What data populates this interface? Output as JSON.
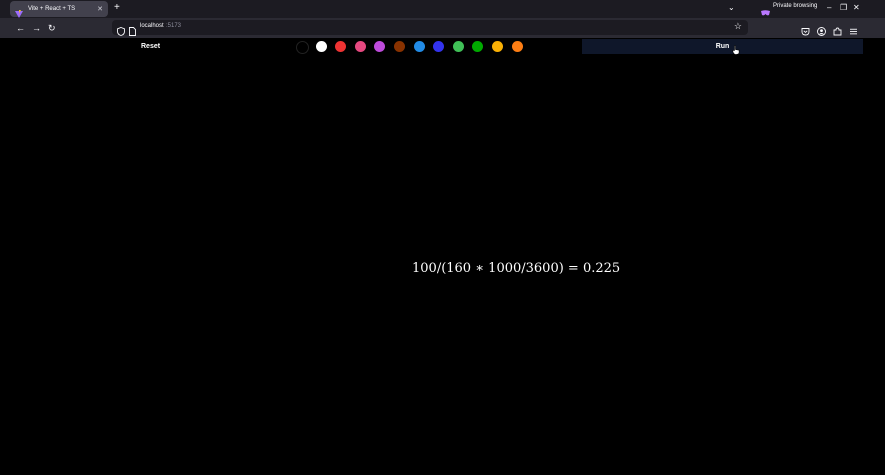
{
  "browser": {
    "tab": {
      "title": "Vite + React + TS",
      "favicon": "vite-logo-icon",
      "close_icon": "close-icon"
    },
    "new_tab_icon": "plus-icon",
    "tab_list_icon": "chevron-down-icon",
    "private_browsing_label": "Private browsing",
    "window_controls": [
      "minimize-icon",
      "restore-icon",
      "close-icon"
    ],
    "nav": {
      "back_icon": "back-arrow-icon",
      "forward_icon": "forward-arrow-icon",
      "reload_icon": "reload-icon"
    },
    "url": {
      "host": "localhost",
      "port": ":5173"
    },
    "toolbar_icons": [
      "pocket-icon",
      "account-icon",
      "extensions-icon",
      "menu-icon"
    ]
  },
  "app": {
    "reset_label": "Reset",
    "run_label": "Run",
    "swatches": [
      "#000000",
      "#ffffff",
      "#ee3333",
      "#e64980",
      "#be4bdb",
      "#893200",
      "#228be6",
      "#3333ee",
      "#40c057",
      "#00aa00",
      "#fab005",
      "#fd7e14"
    ],
    "result_expression": "100/(160 ∗ 1000/3600) = 0.225"
  },
  "colors": {
    "tabbar_bg": "#1c1b22",
    "navbar_bg": "#2b2a33",
    "run_button_bg": "#0f172a",
    "canvas_bg": "#000000"
  }
}
